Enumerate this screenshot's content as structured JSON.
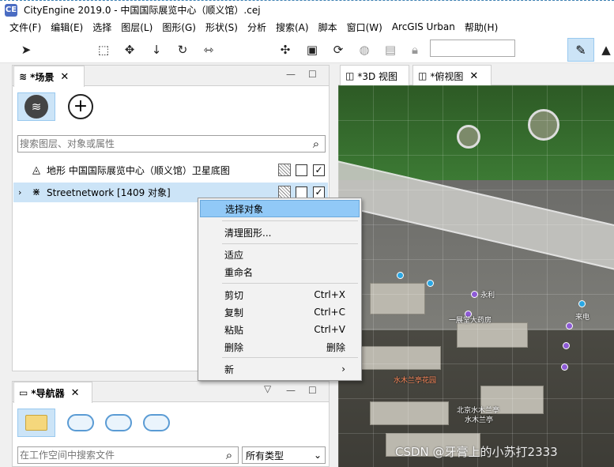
{
  "window": {
    "app_icon": "CE",
    "title": "CityEngine 2019.0 - 中国国际展览中心（顺义馆）.cej"
  },
  "menu": [
    "文件(F)",
    "编辑(E)",
    "选择",
    "图层(L)",
    "图形(G)",
    "形状(S)",
    "分析",
    "搜索(A)",
    "脚本",
    "窗口(W)",
    "ArcGIS Urban",
    "帮助(H)"
  ],
  "toolbar": {
    "search_value": ""
  },
  "scene_panel": {
    "tab_label": "*场景",
    "search_placeholder": "搜索图层、对象或属性",
    "layers": [
      {
        "name": "地形 中国国际展览中心（顺义馆）卫星底图",
        "visible_checked": true
      },
      {
        "name": "Streetnetwork [1409 对象]",
        "visible_checked": true,
        "expand_icon": "chevron-right-icon"
      }
    ]
  },
  "view_tabs": [
    {
      "label": "*3D 视图"
    },
    {
      "label": "*俯视图"
    }
  ],
  "context_menu": {
    "items": [
      {
        "label": "选择对象",
        "shortcut": "",
        "highlighted": true
      },
      {
        "label": "清理图形...",
        "shortcut": ""
      },
      {
        "label": "适应",
        "shortcut": ""
      },
      {
        "label": "重命名",
        "shortcut": ""
      },
      {
        "label": "剪切",
        "shortcut": "Ctrl+X"
      },
      {
        "label": "复制",
        "shortcut": "Ctrl+C"
      },
      {
        "label": "粘贴",
        "shortcut": "Ctrl+V"
      },
      {
        "label": "删除",
        "shortcut": "删除"
      },
      {
        "label": "新",
        "shortcut": "›"
      }
    ]
  },
  "navigator_panel": {
    "tab_label": "*导航器",
    "search_placeholder": "在工作空间中搜索文件",
    "type_select": "所有类型"
  },
  "map_labels": {
    "l1": "永利",
    "l2": "一展堂大药房",
    "l3": "来电",
    "l4": "水木兰亭花园",
    "l5": "北京水木兰亭",
    "l6": "水木兰亭"
  },
  "watermark": "CSDN @牙膏上的小苏打2333",
  "colors": {
    "selection": "#cce4f7",
    "highlight": "#91c9f7"
  }
}
